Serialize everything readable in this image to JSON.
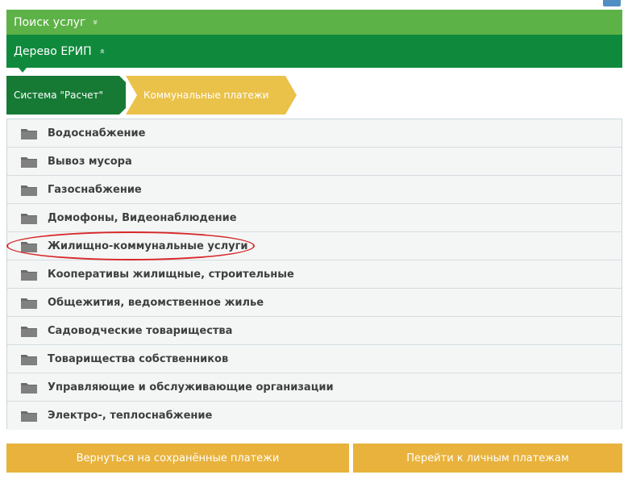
{
  "header": {
    "search_label": "Поиск услуг",
    "search_chevron": "»",
    "tree_label": "Дерево ЕРИП",
    "tree_chevron": "»"
  },
  "breadcrumb": {
    "items": [
      {
        "label": "Система \"Расчет\""
      },
      {
        "label": "Коммунальные платежи"
      }
    ]
  },
  "services": {
    "items": [
      {
        "label": "Водоснабжение",
        "icon": "folder-icon"
      },
      {
        "label": "Вывоз мусора",
        "icon": "folder-icon"
      },
      {
        "label": "Газоснабжение",
        "icon": "folder-icon"
      },
      {
        "label": "Домофоны, Видеонаблюдение",
        "icon": "folder-icon"
      },
      {
        "label": "Жилищно-коммунальные услуги",
        "icon": "folder-icon",
        "highlighted": true
      },
      {
        "label": "Кооперативы жилищные, строительные",
        "icon": "folder-icon"
      },
      {
        "label": "Общежития, ведомственное жилье",
        "icon": "folder-icon"
      },
      {
        "label": "Садоводческие товарищества",
        "icon": "folder-icon"
      },
      {
        "label": "Товарищества собственников",
        "icon": "folder-icon"
      },
      {
        "label": "Управляющие и обслуживающие организации",
        "icon": "folder-icon"
      },
      {
        "label": "Электро-, теплоснабжение",
        "icon": "folder-icon"
      }
    ]
  },
  "actions": {
    "saved_payments": "Вернуться на сохранённые платежи",
    "personal_payments": "Перейти к личным платежам"
  },
  "colors": {
    "search_bar": "#5db247",
    "tree_bar": "#0f8a3c",
    "crumb_active": "#167a35",
    "crumb_current": "#eac24a",
    "button": "#e8b23c",
    "highlight_ring": "#d9282a"
  }
}
